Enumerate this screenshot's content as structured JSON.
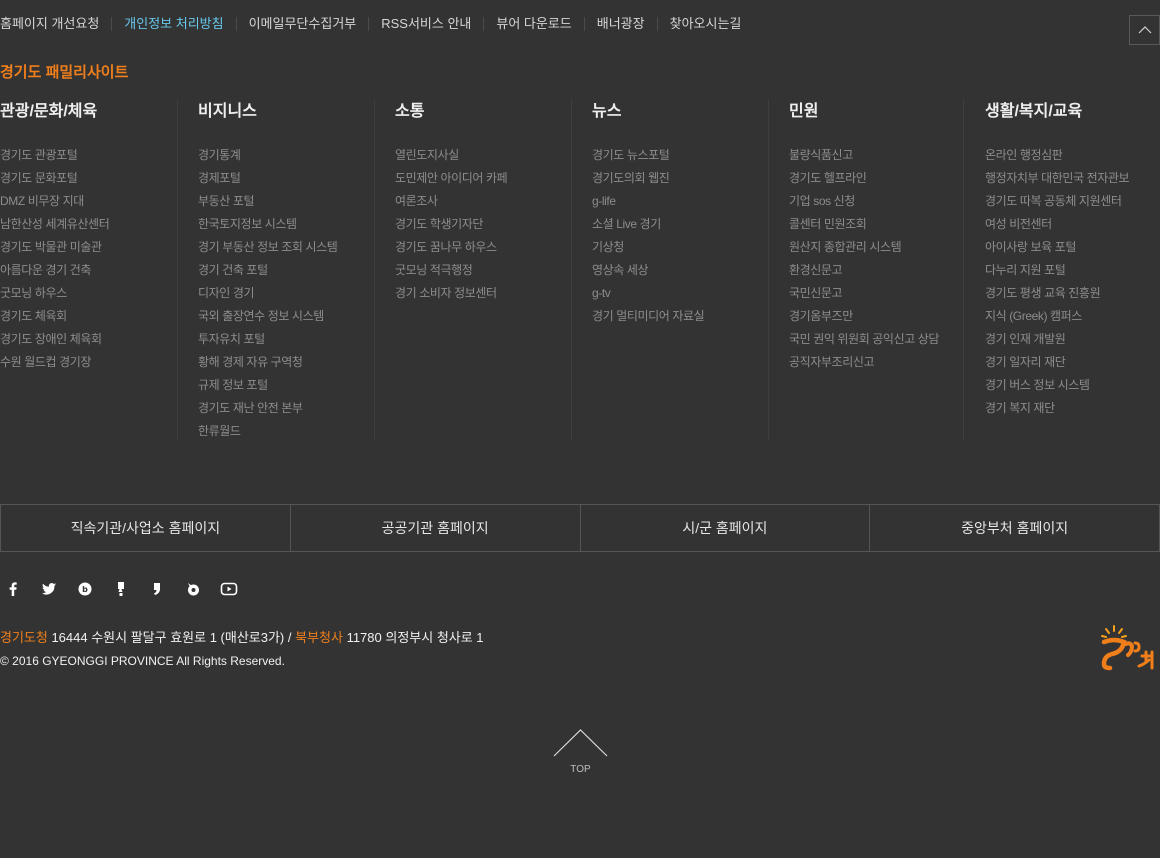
{
  "top_links": [
    {
      "label": "홈페이지 개선요청",
      "highlight": false
    },
    {
      "label": "개인정보 처리방침",
      "highlight": true
    },
    {
      "label": "이메일무단수집거부",
      "highlight": false
    },
    {
      "label": "RSS서비스 안내",
      "highlight": false
    },
    {
      "label": "뷰어 다운로드",
      "highlight": false
    },
    {
      "label": "배너광장",
      "highlight": false
    },
    {
      "label": "찾아오시는길",
      "highlight": false
    }
  ],
  "family_title": "경기도 패밀리사이트",
  "columns": [
    {
      "title": "관광/문화/체육",
      "items": [
        "경기도 관광포털",
        "경기도 문화포털",
        "DMZ 비무장 지대",
        "남한산성 세계유산센터",
        "경기도 박물관 미술관",
        "아름다운 경기 건축",
        "굿모닝 하우스",
        "경기도 체육회",
        "경기도 장애인 체육회",
        "수원 월드컵 경기장"
      ]
    },
    {
      "title": "비지니스",
      "items": [
        "경기통계",
        "경제포털",
        "부동산 포털",
        "한국토지정보 시스템",
        "경기 부동산 정보 조회 시스템",
        "경기 건축 포털",
        "디자인 경기",
        "국외 출장연수 정보 시스템",
        "투자유치 포털",
        "황해 경제 자유 구역청",
        "규제 정보 포털",
        "경기도 재난 안전 본부",
        "한류월드"
      ]
    },
    {
      "title": "소통",
      "items": [
        "열린도지사실",
        "도민제안 아이디어 카페",
        "여론조사",
        "경기도 학생기자단",
        "경기도 꿈나무 하우스",
        "굿모닝 적극행정",
        "경기 소비자 정보센터"
      ]
    },
    {
      "title": "뉴스",
      "items": [
        "경기도 뉴스포털",
        "경기도의회 웹진",
        "g-life",
        "소셜 Live 경기",
        "기상청",
        "영상속 세상",
        "g-tv",
        "경기 멀티미디어 자료실"
      ]
    },
    {
      "title": "민원",
      "items": [
        "불량식품신고",
        "경기도 헬프라인",
        "기업 sos 신청",
        "콜센터 민원조회",
        "원산지 종합관리 시스템",
        "환경신문고",
        "국민신문고",
        "경기옴부즈만",
        "국민 권익 위원회 공익신고 상담",
        "공직자부조리신고"
      ]
    },
    {
      "title": "생활/복지/교육",
      "items": [
        "온라인 행정심판",
        "행정자치부 대한민국 전자관보",
        "경기도 따복 공동체 지원센터",
        "여성 비전센터",
        "아이사랑 보육 포털",
        "다누리 지원 포털",
        "경기도 평생 교육 진흥원",
        "지식 (Greek) 캠퍼스",
        "경기 인재 개발원",
        "경기 일자리 재단",
        "경기 버스 정보 시스템",
        "경기 복지 재단"
      ]
    }
  ],
  "site_buttons": [
    "직속기관/사업소 홈페이지",
    "공공기관 홈페이지",
    "시/군 홈페이지",
    "중앙부처 홈페이지"
  ],
  "sns_icons": [
    "facebook-icon",
    "twitter-icon",
    "blog-icon",
    "kakaostory-icon",
    "kakaotalk-icon",
    "pinterest-icon",
    "youtube-icon"
  ],
  "address": {
    "org1": "경기도청",
    "addr1": " 16444 수원시 팔달구 효원로 1 (매산로3가) / ",
    "org2": "북부청사",
    "addr2": " 11780 의정부시 청사로 1"
  },
  "copyright": "© 2016 GYEONGGI PROVINCE All Rights Reserved.",
  "top_button_label": "TOP",
  "colors": {
    "background": "#333333",
    "accent": "#f07f1b",
    "highlight": "#67c7ea"
  }
}
